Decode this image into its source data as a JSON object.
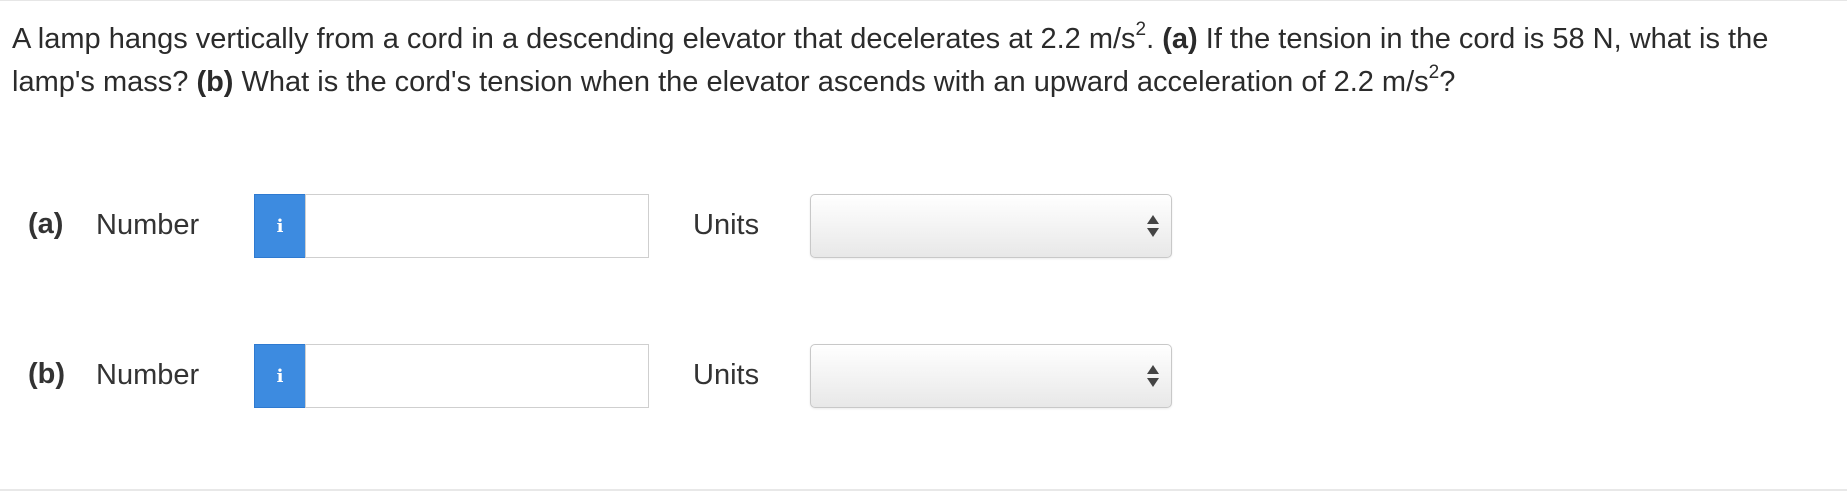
{
  "question": {
    "intro": "A lamp hangs vertically from a cord in a descending elevator that decelerates at 2.2 m/s",
    "exp1": "2",
    "after_exp1": ".",
    "part_a_tag": "(a)",
    "part_a_text": "If the tension in the cord is 58 N, what is the lamp's mass?",
    "part_b_tag": "(b)",
    "part_b_text": "What is the cord's tension when the elevator ascends with an upward acceleration of 2.2 m/s",
    "exp2": "2",
    "after_exp2": "?"
  },
  "answers": [
    {
      "part_label": "(a)",
      "number_label": "Number",
      "info_icon": "info-icon",
      "number_value": "",
      "units_label": "Units",
      "units_selected": ""
    },
    {
      "part_label": "(b)",
      "number_label": "Number",
      "info_icon": "info-icon",
      "number_value": "",
      "units_label": "Units",
      "units_selected": ""
    }
  ],
  "colors": {
    "info_button": "#3d8be0",
    "text": "#333333"
  }
}
